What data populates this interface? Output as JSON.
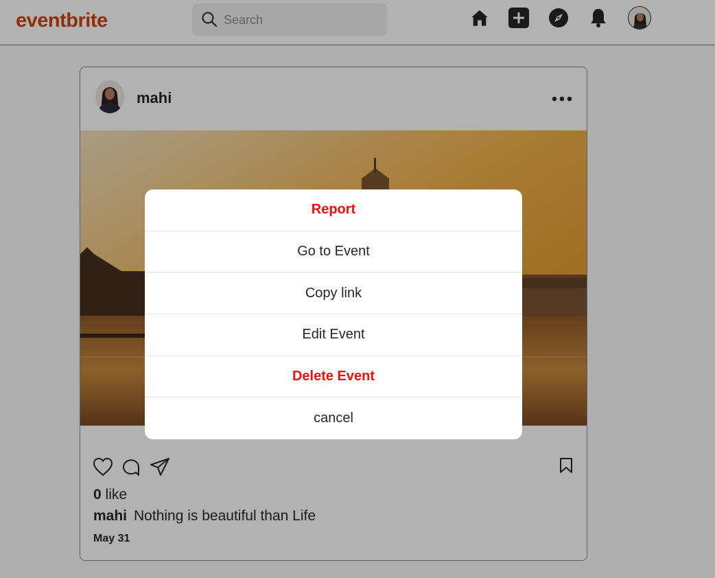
{
  "header": {
    "logo_text": "eventbrite",
    "search_placeholder": "Search",
    "nav_icons": [
      "home-icon",
      "add-icon",
      "explore-compass-icon",
      "notifications-bell-icon",
      "profile-avatar"
    ]
  },
  "post": {
    "username": "mahi",
    "likes_count": "0",
    "likes_label": "like",
    "caption_user": "mahi",
    "caption_text": "Nothing is beautiful than Life",
    "date": "May 31",
    "action_icons": [
      "heart-icon",
      "comment-icon",
      "share-send-icon",
      "bookmark-icon"
    ]
  },
  "menu": {
    "items": [
      {
        "label": "Report",
        "danger": true
      },
      {
        "label": "Go to Event",
        "danger": false
      },
      {
        "label": "Copy link",
        "danger": false
      },
      {
        "label": "Edit Event",
        "danger": false
      },
      {
        "label": "Delete Event",
        "danger": true
      },
      {
        "label": "cancel",
        "danger": false
      }
    ]
  },
  "colors": {
    "brand": "#d1410c",
    "danger": "#ed1010",
    "text": "#262626",
    "overlay": "rgba(0,0,0,0.30)"
  }
}
